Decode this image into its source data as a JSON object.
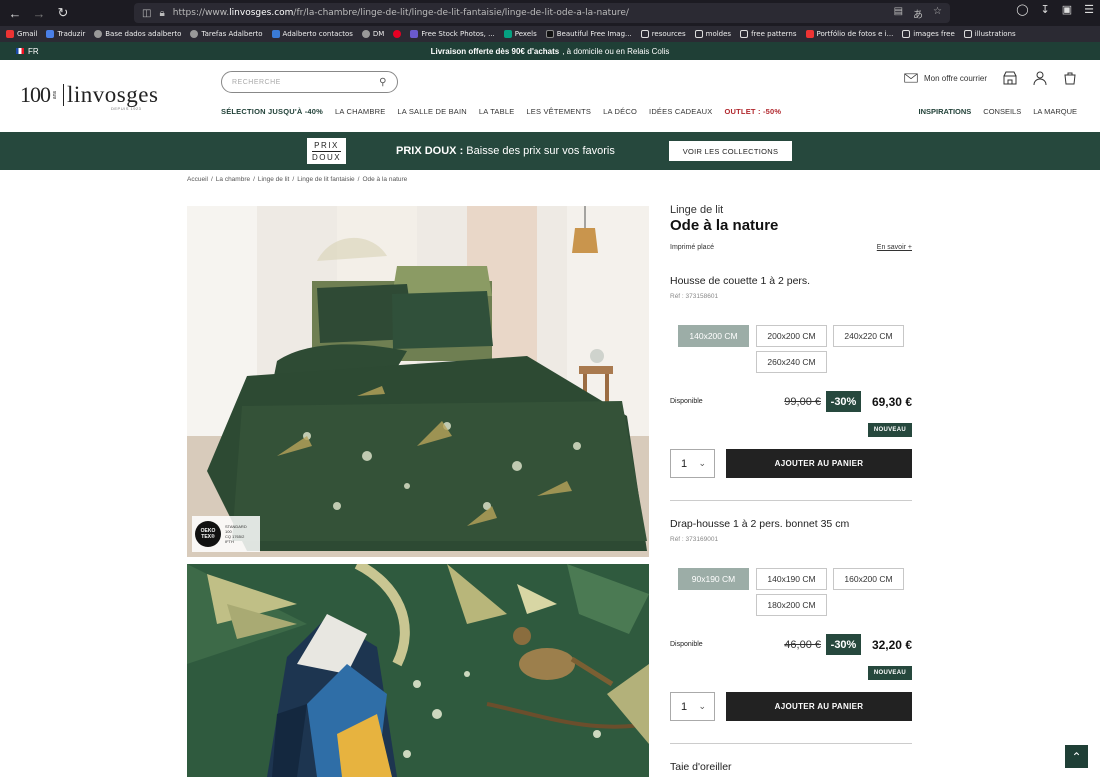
{
  "browser": {
    "url_prefix": "https://www.",
    "url_host": "linvosges.com",
    "url_path": "/fr/la-chambre/linge-de-lit/linge-de-lit-fantaisie/linge-de-lit-ode-a-la-nature/",
    "bookmarks": [
      "Gmail",
      "Traduzir",
      "Base dados adalberto",
      "Tarefas Adalberto",
      "Adalberto contactos",
      "DM",
      "",
      "Free Stock Photos, ...",
      "Pexels",
      "Beautiful Free Imag...",
      "resources",
      "moldes",
      "free patterns",
      "Portfólio de fotos e i...",
      "images free",
      "illustrations"
    ]
  },
  "lang": "FR",
  "promo": {
    "bold": "Livraison offerte dès 90€ d'achats",
    "rest": ", à domicile ou en Relais Colis"
  },
  "logo": {
    "num": "100",
    "ans": "ans",
    "brand": "linvosges",
    "sub": "DEPUIS 1923"
  },
  "search": {
    "placeholder": "RECHERCHE"
  },
  "header": {
    "courrier": "Mon offre courrier"
  },
  "nav": {
    "items": [
      "SÉLECTION JUSQU'À -40%",
      "LA CHAMBRE",
      "LA SALLE DE BAIN",
      "LA TABLE",
      "LES VÊTEMENTS",
      "LA DÉCO",
      "IDÉES CADEAUX",
      "OUTLET : -50%"
    ],
    "right": [
      "INSPIRATIONS",
      "CONSEILS",
      "LA MARQUE"
    ]
  },
  "banner": {
    "logo_top": "PRIX",
    "logo_bottom": "DOUX",
    "bold": "PRIX DOUX :",
    "text": " Baisse des prix sur vos favoris",
    "button": "VOIR LES COLLECTIONS"
  },
  "breadcrumb": [
    "Accueil",
    "/",
    "La chambre",
    "/",
    "Linge de lit",
    "/",
    "Linge de lit fantaisie",
    "/",
    "Ode à la nature"
  ],
  "oeko": {
    "logo": "OEKO TEX®",
    "line1": "STANDARD",
    "line2": "100",
    "line3": "CQ 1765/2",
    "line4": "IFTH"
  },
  "product": {
    "category": "Linge de lit",
    "title": "Ode à la nature",
    "print": "Imprimé placé",
    "more": "En savoir +",
    "items": [
      {
        "title": "Housse de couette 1 à 2 pers.",
        "ref": "Réf : 373158601",
        "sizes": [
          "140x200 CM",
          "200x200 CM",
          "240x220 CM",
          "260x240 CM"
        ],
        "available": "Disponible",
        "old_price": "99,00 €",
        "discount": "-30%",
        "price": "69,30 €",
        "badge": "NOUVEAU",
        "qty": "1",
        "add": "AJOUTER AU PANIER"
      },
      {
        "title": "Drap-housse 1 à 2 pers. bonnet 35 cm",
        "ref": "Réf : 373169001",
        "sizes": [
          "90x190 CM",
          "140x190 CM",
          "160x200 CM",
          "180x200 CM"
        ],
        "available": "Disponible",
        "old_price": "46,00 €",
        "discount": "-30%",
        "price": "32,20 €",
        "badge": "NOUVEAU",
        "qty": "1",
        "add": "AJOUTER AU PANIER"
      },
      {
        "title": "Taie d'oreiller"
      }
    ]
  }
}
